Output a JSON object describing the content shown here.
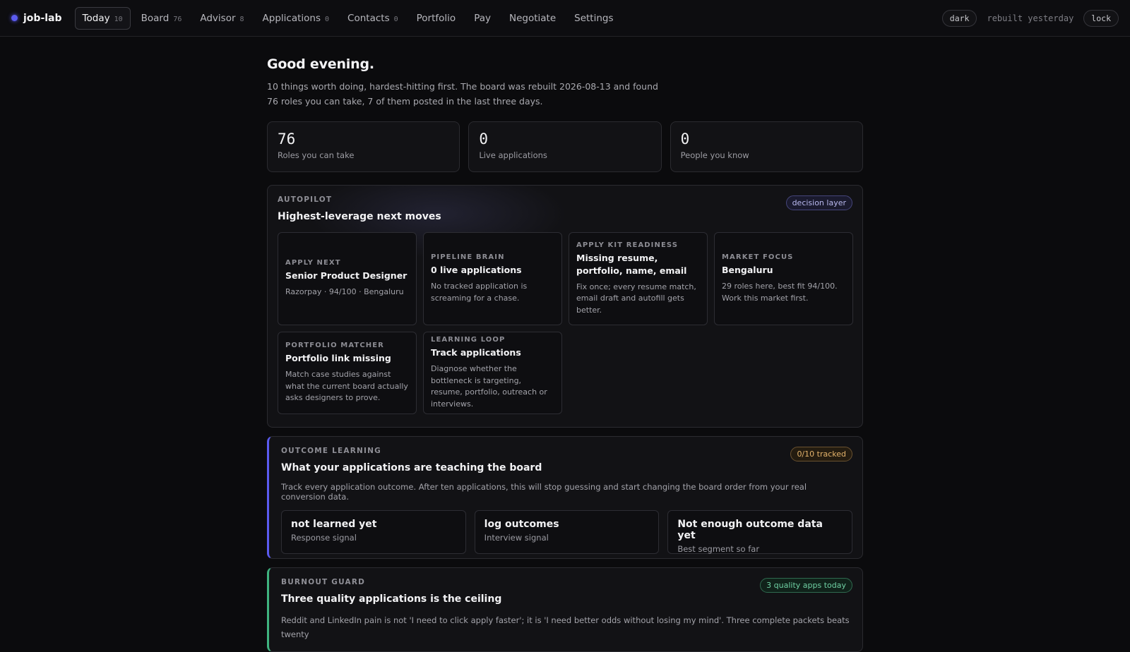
{
  "brand": {
    "name": "job-lab"
  },
  "nav": {
    "items": [
      {
        "label": "Today",
        "count": "10",
        "active": true
      },
      {
        "label": "Board",
        "count": "76"
      },
      {
        "label": "Advisor",
        "count": "8"
      },
      {
        "label": "Applications",
        "count": "0"
      },
      {
        "label": "Contacts",
        "count": "0"
      },
      {
        "label": "Portfolio",
        "count": ""
      },
      {
        "label": "Pay",
        "count": ""
      },
      {
        "label": "Negotiate",
        "count": ""
      },
      {
        "label": "Settings",
        "count": ""
      }
    ]
  },
  "topright": {
    "theme": "dark",
    "rebuilt": "rebuilt yesterday",
    "lock": "lock"
  },
  "greeting": "Good evening.",
  "intro": "10 things worth doing, hardest-hitting first. The board was rebuilt 2026-08-13 and found 76 roles you can take, 7 of them posted in the last three days.",
  "stats": [
    {
      "value": "76",
      "label": "Roles you can take"
    },
    {
      "value": "0",
      "label": "Live applications"
    },
    {
      "value": "0",
      "label": "People you know"
    }
  ],
  "autopilot": {
    "kicker": "AUTOPILOT",
    "title": "Highest-leverage next moves",
    "badge": "decision layer",
    "cards": [
      {
        "kicker": "APPLY NEXT",
        "title": "Senior Product Designer",
        "body": "Razorpay · 94/100 · Bengaluru"
      },
      {
        "kicker": "PIPELINE BRAIN",
        "title": "0 live applications",
        "body": "No tracked application is screaming for a chase."
      },
      {
        "kicker": "APPLY KIT READINESS",
        "title": "Missing resume, portfolio, name, email",
        "body": "Fix once; every resume match, email draft and autofill gets better."
      },
      {
        "kicker": "MARKET FOCUS",
        "title": "Bengaluru",
        "body": "29 roles here, best fit 94/100. Work this market first."
      },
      {
        "kicker": "PORTFOLIO MATCHER",
        "title": "Portfolio link missing",
        "body": "Match case studies against what the current board actually asks designers to prove."
      },
      {
        "kicker": "LEARNING LOOP",
        "title": "Track applications",
        "body": "Diagnose whether the bottleneck is targeting, resume, portfolio, outreach or interviews."
      }
    ]
  },
  "outcome": {
    "kicker": "OUTCOME LEARNING",
    "title": "What your applications are teaching the board",
    "badge": "0/10 tracked",
    "desc": "Track every application outcome. After ten applications, this will stop guessing and start changing the board order from your real conversion data.",
    "signals": [
      {
        "title": "not learned yet",
        "label": "Response signal"
      },
      {
        "title": "log outcomes",
        "label": "Interview signal"
      },
      {
        "title": "Not enough outcome data yet",
        "label": "Best segment so far"
      }
    ]
  },
  "burnout": {
    "kicker": "BURNOUT GUARD",
    "title": "Three quality applications is the ceiling",
    "badge": "3 quality apps today",
    "desc": "Reddit and LinkedIn pain is not 'I need to click apply faster'; it is 'I need better odds without losing my mind'. Three complete packets beats twenty"
  },
  "colors": {
    "accent": "#5b5bf0",
    "success": "#3fb37f",
    "warning": "#e4b36b",
    "background": "#0b0b0d"
  }
}
